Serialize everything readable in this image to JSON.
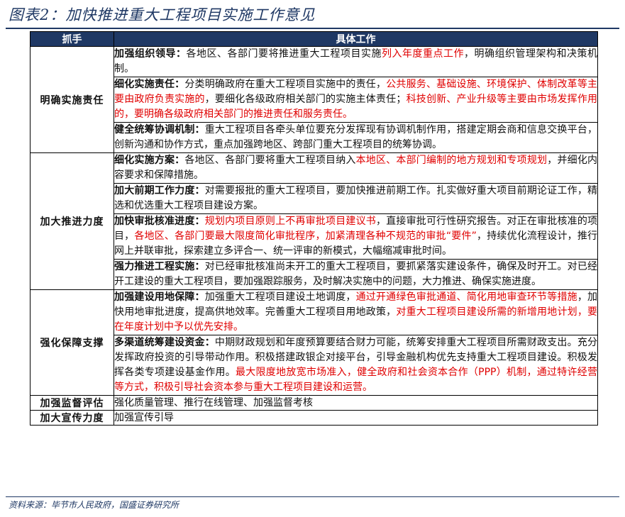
{
  "title": "图表2：加快推进重大工程项目实施工作意见",
  "table": {
    "headers": [
      "抓手",
      "具体工作"
    ],
    "groups": [
      {
        "category": "明确实施责任",
        "items": [
          {
            "lead": "加强组织领导：",
            "segments": [
              {
                "text": "各地区、各部门要将推进重大工程项目实施",
                "red": false
              },
              {
                "text": "列入年度重点工作",
                "red": true
              },
              {
                "text": "，明确组织管理架构和决策机制。",
                "red": false
              }
            ]
          },
          {
            "lead": "细化实施责任：",
            "segments": [
              {
                "text": "分类明确政府在重大工程项目实施中的责任，",
                "red": false
              },
              {
                "text": "公共服务、基础设施、环境保护、体制改革等主要由政府负责实施的",
                "red": true
              },
              {
                "text": "，要细化各级政府相关部门的实施主体责任；",
                "red": false
              },
              {
                "text": "科技创新、产业升级等主要由市场发挥作用的，要明确各级政府相关部门的推进责任和服务责任。",
                "red": true
              }
            ]
          },
          {
            "lead": "健全统筹协调机制：",
            "segments": [
              {
                "text": "重大工程项目各牵头单位要充分发挥现有协调机制作用，搭建定期会商和信息交换平台，创新沟通和协作方式，重点加强跨地区、跨部门重大工程项目的统筹协调。",
                "red": false
              }
            ]
          }
        ]
      },
      {
        "category": "加大推进力度",
        "items": [
          {
            "lead": "细化实施方案：",
            "segments": [
              {
                "text": "各地区、各部门要将重大工程项目纳入",
                "red": false
              },
              {
                "text": "本地区、本部门编制的地方规划和专项规划",
                "red": true
              },
              {
                "text": "，并细化内容要求和保障措施。",
                "red": false
              }
            ]
          },
          {
            "lead": "加大前期工作力度：",
            "segments": [
              {
                "text": "对需要报批的重大工程项目，要加快推进前期工作。扎实做好重大项目前期论证工作，精选和优选重大工程项目建设方案。",
                "red": false
              }
            ]
          },
          {
            "lead": "加快审批核准进度：",
            "segments": [
              {
                "text": "规划内项目原则上不再审批项目建议书",
                "red": true
              },
              {
                "text": "，直接审批可行性研究报告。对正在审批核准的项目，",
                "red": false
              },
              {
                "text": "各地区、各部门要最大限度简化审批程序，加紧清理各种不规范的审批“要件”",
                "red": true
              },
              {
                "text": "，持续优化流程设计，推行网上并联审批，探索建立多评合一、统一评审的新模式，大幅缩减审批时间。",
                "red": false
              }
            ]
          },
          {
            "lead": "强力推进工程实施：",
            "segments": [
              {
                "text": "对已经审批核准尚未开工的重大工程项目，要抓紧落实建设条件，确保及时开工。对已经开工建设的重大工程项目，要加强跟踪服务，及时解决实施中的问题，大力推进、确保实施进度。",
                "red": false
              }
            ]
          }
        ]
      },
      {
        "category": "强化保障支撑",
        "items": [
          {
            "lead": "加强建设用地保障：",
            "segments": [
              {
                "text": "加强重大工程项目建设土地调度，",
                "red": false
              },
              {
                "text": "通过开通绿色审批通道、简化用地审查环节等措施",
                "red": true
              },
              {
                "text": "，加快用地审批进度，提高供地效率。完善重大工程项目用地政策，",
                "red": false
              },
              {
                "text": "对重大工程项目建设所需的新增用地计划，要在年度计划中予以优先安排。",
                "red": true
              }
            ]
          },
          {
            "lead": "多渠道统筹建设资金：",
            "segments": [
              {
                "text": "中期财政规划和年度预算要结合财力可能，统筹安排重大工程项目所需财政支出。充分发挥政府投资的引导带动作用。积极搭建政银企对接平台，引导金融机构优先支持重大工程项目建设。积极发挥各类专项建设基金作用。",
                "red": false
              },
              {
                "text": "最大限度地放宽市场准入，健全政府和社会资本合作（PPP）机制，通过特许经营等方式，积极引导社会资本参与重大工程项目建设和运营。",
                "red": true
              }
            ]
          }
        ]
      },
      {
        "category": "加强监督评估",
        "items": [
          {
            "lead": "",
            "segments": [
              {
                "text": "强化质量管理、推行在线管理、加强监督考核",
                "red": false
              }
            ]
          }
        ]
      },
      {
        "category": "加大宣传力度",
        "items": [
          {
            "lead": "",
            "segments": [
              {
                "text": "加强宣传引导",
                "red": false
              }
            ]
          }
        ]
      }
    ]
  },
  "source": "资料来源：毕节市人民政府，国盛证券研究所"
}
